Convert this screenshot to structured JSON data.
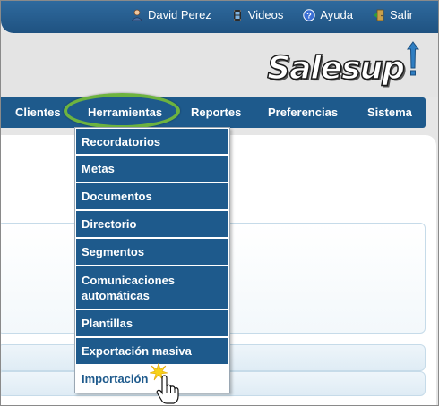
{
  "topbar": {
    "links": [
      {
        "label": "David Perez",
        "icon": "user-icon"
      },
      {
        "label": "Videos",
        "icon": "film-icon"
      },
      {
        "label": "Ayuda",
        "icon": "help-icon"
      },
      {
        "label": "Salir",
        "icon": "exit-door-icon"
      }
    ]
  },
  "logo": {
    "text": "Salesup",
    "icon": "exclamation-logo-icon"
  },
  "nav": {
    "items": [
      "Clientes",
      "Herramientas",
      "Reportes",
      "Preferencias",
      "Sistema"
    ],
    "active": "Herramientas",
    "highlight_color": "#6db33f"
  },
  "dropdown": {
    "items": [
      "Recordatorios",
      "Metas",
      "Documentos",
      "Directorio",
      "Segmentos",
      "Comunicaciones automáticas",
      "Plantillas",
      "Exportación masiva",
      "Importación"
    ],
    "hovered": "Importación"
  },
  "colors": {
    "nav_bg": "#1e5a8c",
    "topbar_bg": "#2f6a9e",
    "menu_item_bg": "#1e5a8c"
  }
}
